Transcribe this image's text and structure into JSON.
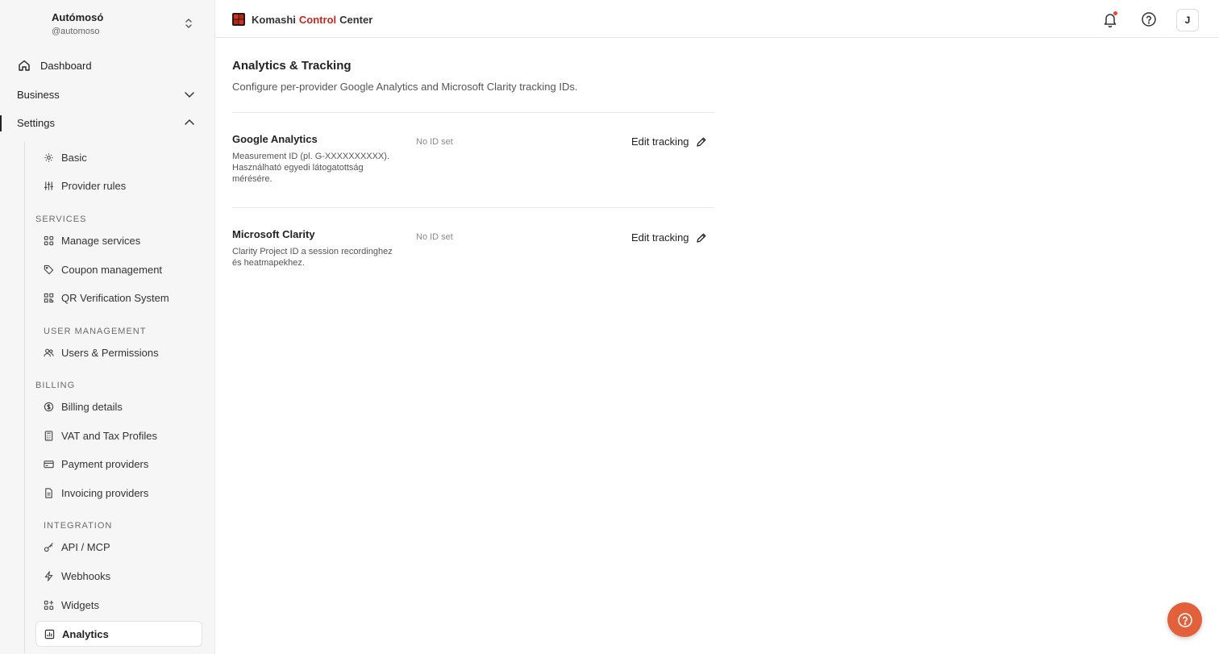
{
  "account": {
    "name": "Autómosó",
    "handle": "@automoso"
  },
  "nav": {
    "dashboard": "Dashboard",
    "business": "Business",
    "settings": "Settings",
    "basic": "Basic",
    "provider_rules": "Provider rules",
    "services_section": "SERVICES",
    "manage_services": "Manage services",
    "coupon_management": "Coupon management",
    "qr_verification": "QR Verification System",
    "user_mgmt_section": "USER MANAGEMENT",
    "users_permissions": "Users & Permissions",
    "billing_section": "BILLING",
    "billing_details": "Billing details",
    "vat_tax": "VAT and Tax Profiles",
    "payment_providers": "Payment providers",
    "invoicing_providers": "Invoicing providers",
    "integration_section": "INTEGRATION",
    "api_mcp": "API / MCP",
    "webhooks": "Webhooks",
    "widgets": "Widgets",
    "analytics": "Analytics"
  },
  "header": {
    "brand_part1": "Komashi",
    "brand_part2": "Control",
    "brand_part3": "Center",
    "avatar_initial": "J"
  },
  "page": {
    "title": "Analytics & Tracking",
    "description": "Configure per-provider Google Analytics and Microsoft Clarity tracking IDs."
  },
  "providers": [
    {
      "title": "Google Analytics",
      "description": "Measurement ID (pl. G-XXXXXXXXXX). Használható egyedi látogatottság mérésére.",
      "value": "No ID set",
      "action": "Edit tracking"
    },
    {
      "title": "Microsoft Clarity",
      "description": "Clarity Project ID a session recordinghez és heatmapekhez.",
      "value": "No ID set",
      "action": "Edit tracking"
    }
  ],
  "colors": {
    "accent": "#c4281c",
    "fab": "#e2613b",
    "notification_dot": "#e8432f"
  }
}
